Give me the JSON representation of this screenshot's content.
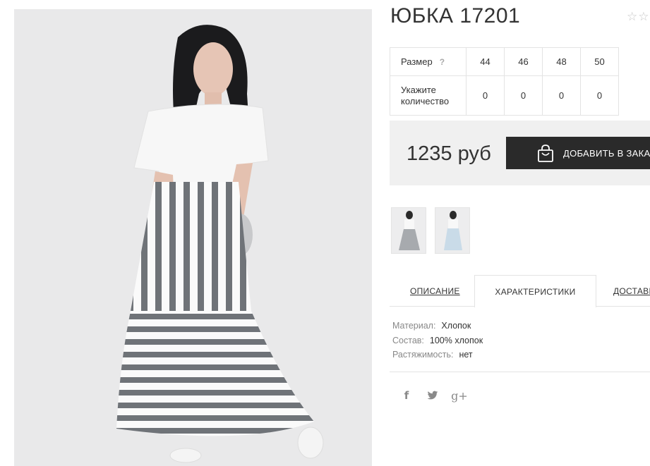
{
  "product": {
    "title": "ЮБКА 17201",
    "rating_stars": "☆☆",
    "price": "1235 руб",
    "add_to_cart": "ДОБАВИТЬ В ЗАКАЗ"
  },
  "sizes": {
    "size_label": "Размер",
    "help": "?",
    "qty_label": "Укажите количество",
    "columns": [
      {
        "size": "44",
        "qty": "0"
      },
      {
        "size": "46",
        "qty": "0"
      },
      {
        "size": "48",
        "qty": "0"
      },
      {
        "size": "50",
        "qty": "0"
      }
    ]
  },
  "tabs": [
    {
      "label": "ОПИСАНИЕ"
    },
    {
      "label": "ХАРАКТЕРИСТИКИ",
      "active": true
    },
    {
      "label": "ДОСТАВКА"
    }
  ],
  "characteristics": [
    {
      "key": "Материал:",
      "value": "Хлопок"
    },
    {
      "key": "Состав:",
      "value": "100% хлопок"
    },
    {
      "key": "Растяжимость:",
      "value": "нет"
    }
  ],
  "social": {
    "facebook": "f",
    "googleplus": "g+"
  },
  "colors": {
    "button_bg": "#2a2a2a",
    "price_bg": "#f0f0f0",
    "stripe_gray": "#6f7378",
    "skirt_blue": "#c9dbe8"
  },
  "icons": [
    "shopping-bag-icon",
    "facebook-icon",
    "twitter-icon",
    "google-plus-icon",
    "star-icon"
  ]
}
